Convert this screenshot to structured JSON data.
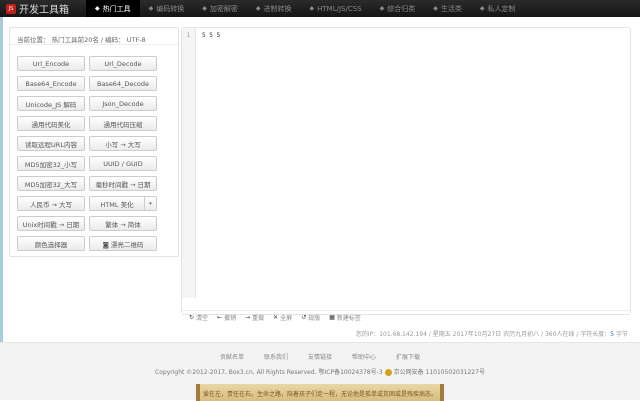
{
  "nav": {
    "logo_icon": "JS",
    "logo_text": "开发工具箱",
    "items": [
      {
        "label": "热门工具",
        "active": true
      },
      {
        "label": "编码转换"
      },
      {
        "label": "加密解密"
      },
      {
        "label": "进制转换"
      },
      {
        "label": "HTML/JS/CSS"
      },
      {
        "label": "综合归类"
      },
      {
        "label": "生活类"
      },
      {
        "label": "私人定制"
      }
    ]
  },
  "left": {
    "breadcrumb": "当前位置： 热门工具前20名   /   编码： UTF-8",
    "buttons": [
      "Url_Encode",
      "Url_Decode",
      "Base64_Encode",
      "Base64_Decode",
      "Unicode_JS 解码",
      "Json_Decode",
      "通用代码美化",
      "通用代码压缩",
      "读取远程URL内容",
      "小写 → 大写",
      "MD5加密32_小写",
      "UUID / GUID",
      "MD5加密32_大写",
      "毫秒时间戳 → 日期",
      "人民币 → 大写",
      "HTML 美化",
      "Unix时间戳 → 日期",
      "繁体 → 简体",
      "颜色选择器",
      "◙ 漂亮二维码"
    ],
    "dropdown_icon": "▾"
  },
  "editor": {
    "line_number": "1",
    "content": "5 5 5",
    "tools": [
      {
        "icon": "↻",
        "label": "清空"
      },
      {
        "icon": "←",
        "label": "撤销"
      },
      {
        "icon": "→",
        "label": "重做"
      },
      {
        "icon": "✕",
        "label": "全屏"
      },
      {
        "icon": "↺",
        "label": "现版"
      },
      {
        "icon": "▦",
        "label": "新建标签"
      }
    ]
  },
  "status": {
    "prefix": "您的IP：",
    "ip": "101.68.142.194",
    "rest": " / 星期五 2017年10月27日 农历九月初八 / 360人在线 / 字符长度：",
    "length": "5",
    "suffix": " 字节"
  },
  "footer": {
    "links": [
      "贡献名单",
      "联系我们",
      "友情链接",
      "帮助中心",
      "扩展下载"
    ],
    "copyright": "Copyright ©2012-2017, Box3.cn, All Rights Reserved. 鄂ICP备10024378号-3",
    "police": "京公网安备 11010502031227号",
    "banner": "爱在左，责任在右。生命之路，陪着孩子们走一程，无论他是孤单或贫困或是残疾病态。"
  }
}
